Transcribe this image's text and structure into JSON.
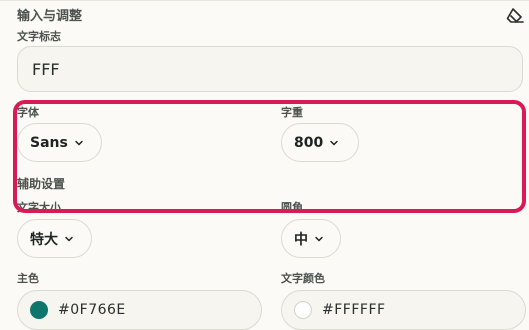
{
  "panel": {
    "title": "输入与调整",
    "eraser_icon": "eraser-icon"
  },
  "text_field": {
    "label": "文字标志",
    "value": "FFF"
  },
  "font": {
    "label": "字体",
    "value": "Sans"
  },
  "weight": {
    "label": "字重",
    "value": "800"
  },
  "auxiliary": {
    "title": "辅助设置"
  },
  "text_size": {
    "label": "文字大小",
    "value": "特大"
  },
  "corner": {
    "label": "圆角",
    "value": "中"
  },
  "primary_color": {
    "label": "主色",
    "value": "#0F766E",
    "swatch": "#0F766E"
  },
  "text_color": {
    "label": "文字颜色",
    "value": "#FFFFFF",
    "swatch": "#FFFFFF"
  },
  "highlight_color": "#d81b55"
}
